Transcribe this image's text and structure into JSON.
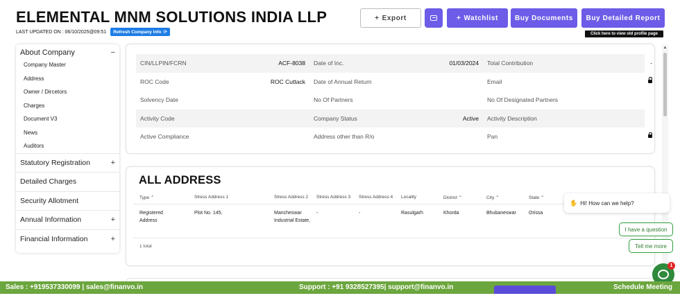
{
  "header": {
    "company_name": "ELEMENTAL MNM SOLUTIONS INDIA LLP",
    "last_updated": "LAST UPDATED ON : 06/10/2025@09:51",
    "refresh_label": "Refresh Company Info",
    "export_label": "Export",
    "watchlist_label": "Watchlist",
    "buy_documents_label": "Buy Documents",
    "buy_report_label": "Buy Detailed Report",
    "old_profile_tip": "Click here to view old profile page"
  },
  "sidebar": {
    "about_title": "About Company",
    "about_items": [
      "Company Master",
      "Address",
      "Owner / Dircetors",
      "Charges",
      "Document V3",
      "News",
      "Auditors"
    ],
    "sections": [
      {
        "label": "Statutory Registration",
        "toggle": "+"
      },
      {
        "label": "Detailed Charges",
        "toggle": ""
      },
      {
        "label": "Security Allotment",
        "toggle": ""
      },
      {
        "label": "Annual Information",
        "toggle": "+"
      },
      {
        "label": "Financial Information",
        "toggle": "+"
      }
    ]
  },
  "company_info": {
    "rows": [
      [
        {
          "label": "CIN/LLPIN/FCRN",
          "value": "ACF-8038"
        },
        {
          "label": "Date of Inc.",
          "value": "01/03/2024"
        },
        {
          "label": "Total Contribution",
          "value": "-"
        }
      ],
      [
        {
          "label": "ROC Code",
          "value": "ROC Cuttack"
        },
        {
          "label": "Date of Annual Return",
          "value": ""
        },
        {
          "label": "Email",
          "value": ""
        }
      ],
      [
        {
          "label": "Solvency Date",
          "value": ""
        },
        {
          "label": "No Of Partners",
          "value": ""
        },
        {
          "label": "No Of Designated Partners",
          "value": ""
        }
      ],
      [
        {
          "label": "Activity Code",
          "value": ""
        },
        {
          "label": "Company Status",
          "value": "Active"
        },
        {
          "label": "Activity Description",
          "value": ""
        }
      ],
      [
        {
          "label": "Active Compliance",
          "value": ""
        },
        {
          "label": "Address other than R/o",
          "value": ""
        },
        {
          "label": "Pan",
          "value": ""
        }
      ]
    ]
  },
  "addresses": {
    "title": "ALL ADDRESS",
    "columns": [
      "Type ⌃",
      "Stress Address 1",
      "Stress Address 2",
      "Stress Address 3",
      "Stress Address 4",
      "Locality",
      "District ⌃",
      "City ⌃",
      "State ⌃"
    ],
    "row": {
      "type": "Registered Address",
      "addr1": "Plot No. 145,",
      "addr2": "Mancheswar Industrial Estate,",
      "addr3": "-",
      "addr4": "-",
      "locality": "Rasulgarh",
      "district": "Khorda",
      "city": "Bhubaneswar",
      "state": "Orissa"
    },
    "total": "1 total"
  },
  "chat": {
    "greeting": "Hi! How can we help?",
    "option1": "I have a question",
    "option2": "Tell me more",
    "badge": "1"
  },
  "footer": {
    "sales": "Sales : +919537330099 | sales@finanvo.in",
    "support": "Support : +91 9328527395| support@finanvo.in",
    "schedule": "Schedule Meeting"
  },
  "colors": {
    "accent": "#6c5ce7",
    "footer": "#6ca63e",
    "refresh": "#1f7de6"
  }
}
